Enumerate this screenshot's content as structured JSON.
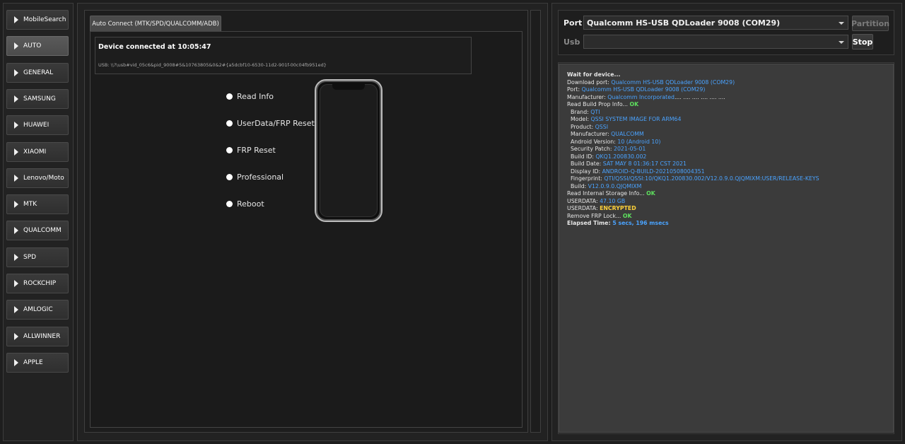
{
  "sidebar": {
    "items": [
      {
        "label": "MobileSearch",
        "active": false
      },
      {
        "label": "AUTO",
        "active": true
      },
      {
        "label": "GENERAL",
        "active": false
      },
      {
        "label": "SAMSUNG",
        "active": false
      },
      {
        "label": "HUAWEI",
        "active": false
      },
      {
        "label": "XIAOMI",
        "active": false
      },
      {
        "label": "Lenovo/Moto",
        "active": false
      },
      {
        "label": "MTK",
        "active": false
      },
      {
        "label": "QUALCOMM",
        "active": false
      },
      {
        "label": "SPD",
        "active": false
      },
      {
        "label": "ROCKCHIP",
        "active": false
      },
      {
        "label": "AMLOGIC",
        "active": false
      },
      {
        "label": "ALLWINNER",
        "active": false
      },
      {
        "label": "APPLE",
        "active": false
      }
    ]
  },
  "center": {
    "tab_label": "Auto Connect (MTK/SPD/QUALCOMM/ADB)",
    "status_title": "Device connected at 10:05:47",
    "status_usb": "USB: \\\\?\\usb#vid_05c6&pid_9008#5&10763805&0&2#{a5dcbf10-6530-11d2-901f-00c04fb951ed}",
    "options": [
      "Read Info",
      "UserData/FRP Reset",
      "FRP Reset",
      "Professional",
      "Reboot"
    ]
  },
  "right": {
    "port_label": "Port",
    "port_value": "Qualcomm HS-USB QDLoader 9008 (COM29)",
    "usb_label": "Usb",
    "usb_value": "",
    "partition_label": "Partition",
    "stop_label": "Stop",
    "log": [
      {
        "label": "Wait for device...",
        "value": "",
        "kind": "plain",
        "bold": true
      },
      {
        "label": "Download port: ",
        "value": "Qualcomm HS-USB QDLoader 9008 (COM29)",
        "kind": "v"
      },
      {
        "label": "Port: ",
        "value": "Qualcomm HS-USB QDLoader 9008 (COM29)",
        "kind": "v"
      },
      {
        "label": "Manufacturer: ",
        "value": "Qualcomm Incorporated",
        "kind": "v",
        "suffix": ".... .... .... .... .... ...."
      },
      {
        "label": "Read Build Prop Info... ",
        "value": "OK",
        "kind": "ok"
      },
      {
        "label": "  Brand: ",
        "value": "QTI",
        "kind": "v"
      },
      {
        "label": "  Model: ",
        "value": "QSSI SYSTEM IMAGE FOR ARM64",
        "kind": "v"
      },
      {
        "label": "  Product: ",
        "value": "QSSI",
        "kind": "v"
      },
      {
        "label": "  Manufacturer: ",
        "value": "QUALCOMM",
        "kind": "v"
      },
      {
        "label": "  Android Version: ",
        "value": "10 (Android 10)",
        "kind": "v"
      },
      {
        "label": "  Security Patch: ",
        "value": "2021-05-01",
        "kind": "v"
      },
      {
        "label": "  Build ID: ",
        "value": "QKQ1.200830.002",
        "kind": "v"
      },
      {
        "label": "  Build Date: ",
        "value": "SAT MAY  8 01:36:17 CST 2021",
        "kind": "v"
      },
      {
        "label": "  Display ID: ",
        "value": "ANDROID-Q-BUILD-20210508004351",
        "kind": "v"
      },
      {
        "label": "  Fingerprint: ",
        "value": "QTI/QSSI/QSSI:10/QKQ1.200830.002/V12.0.9.0.QJQMIXM:USER/RELEASE-KEYS",
        "kind": "v"
      },
      {
        "label": "  Build: ",
        "value": "V12.0.9.0.QJQMIXM",
        "kind": "v"
      },
      {
        "label": "Read Internal Storage Info... ",
        "value": "OK",
        "kind": "ok"
      },
      {
        "label": "USERDATA: ",
        "value": "47.10 GB",
        "kind": "v"
      },
      {
        "label": "USERDATA: ",
        "value": "ENCRYPTED",
        "kind": "warn"
      },
      {
        "label": "Remove FRP Lock... ",
        "value": "OK",
        "kind": "ok"
      },
      {
        "label": "Elapsed Time: ",
        "value": "5 secs, 196 msecs",
        "kind": "v",
        "bold": true
      }
    ]
  },
  "colors": {
    "value_blue": "#4aa3ff",
    "ok_green": "#5ee05e",
    "warn_yellow": "#ffd23a"
  },
  "icons": {
    "nav_arrow": "triangle-right-icon",
    "dropdown": "chevron-down-icon",
    "radio": "radio-dot-icon",
    "phone": "phone-illustration"
  }
}
